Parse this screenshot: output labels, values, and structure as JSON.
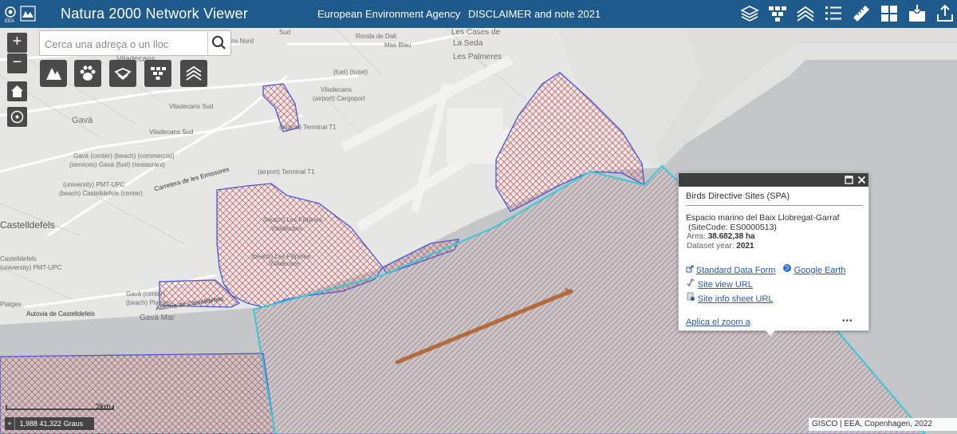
{
  "header": {
    "title": "Natura 2000 Network Viewer",
    "logo_text": "EEA",
    "links": {
      "eea": "European Environment Agency",
      "disclaimer": "DISCLAIMER and note 2021"
    },
    "widgets": [
      "layers-icon",
      "sites-icon",
      "basemap-icon",
      "legend-icon",
      "measure-icon",
      "gallery-icon",
      "export-icon",
      "share-icon"
    ]
  },
  "search": {
    "placeholder": "Cerca una adreça o un lloc",
    "value": ""
  },
  "zoom": {
    "in_label": "+",
    "out_label": "−"
  },
  "quick_tools": [
    "habitat-icon",
    "species-icon",
    "bird-icon",
    "site-icon",
    "marine-icon"
  ],
  "map_labels": [
    "Viladecans",
    "Viladecans Sud",
    "Gavà",
    "Viladecans Sud",
    "Gavà (center) (beach) (commercial)",
    "(services) Gavà (fuel) (restaurant)",
    "(university) PMT-UPC",
    "(beach) Castelldefels (center)",
    "Carretera de les Emissores",
    "Castelldefels",
    "Castelldefels",
    "(university) PMT-UPC",
    "Gavà (center)",
    "(beach) Platges",
    "Platges",
    "Autovia de Castelldefels",
    "Autovia de Castelldefels",
    "Gavà Mar",
    "(beach) Les Filipines",
    "Viladecans",
    "(beach) Les Filipines",
    "Viladecans",
    "(airport) Terminal T1",
    "(airport) Terminal T1",
    "(airport) Cargoport",
    "Viladecans",
    "(fuel) (hotel)",
    "Ronda de Dalt",
    "Mas Blau",
    "Les Cases de",
    "La Seda",
    "Les Palmeres",
    "Sud",
    "ns Nord"
  ],
  "popup": {
    "title": "Birds Directive Sites (SPA)",
    "site_name": "Espacio marino del Baix Llobregat-Garraf",
    "site_code": "(SiteCode: ES0000513)",
    "area_label": "Area:",
    "area_value": "38.682,38 ha",
    "year_label": "Dataset year:",
    "year_value": "2021",
    "links": {
      "standard_data_form": "Standard Data Form",
      "google_earth": "Google Earth",
      "site_view_url": "Site view URL",
      "site_info_sheet_url": "Site info sheet URL"
    },
    "zoom_link": "Aplica el zoom a",
    "more": "•••"
  },
  "scalebar": {
    "label": "2km"
  },
  "coordinates": {
    "toggle": "+",
    "text": "1,988 41,322 Graus"
  },
  "attribution": "GISCO | EEA, Copenhagen, 2022",
  "colors": {
    "header": "#1f5a8c",
    "sea": "#c4c6c8",
    "land": "#e6e6e4",
    "site_boundary": "#4a57d8",
    "site_hatch": "#c0505a",
    "marine_boundary": "#38c8d8",
    "route": "#b36a3c"
  }
}
